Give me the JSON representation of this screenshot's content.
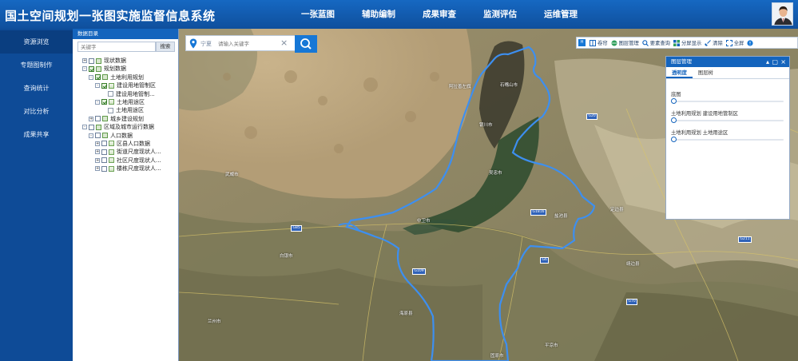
{
  "header": {
    "title": "国土空间规划一张图实施监督信息系统",
    "nav": [
      "一张蓝图",
      "辅助编制",
      "成果审查",
      "监测评估",
      "运维管理"
    ]
  },
  "rail": {
    "items": [
      "资源浏览",
      "专题图制作",
      "查询统计",
      "对比分析",
      "成果共享"
    ]
  },
  "catalog": {
    "title": "数据目录",
    "search_placeholder": "关键字",
    "search_button": "搜索",
    "tree": [
      {
        "label": "现状数据",
        "level": 0,
        "toggle": "+",
        "checked": false,
        "icon": "folder"
      },
      {
        "label": "规划数据",
        "level": 0,
        "toggle": "-",
        "checked": true,
        "icon": "folder"
      },
      {
        "label": "土地利用规划",
        "level": 1,
        "toggle": "-",
        "checked": true,
        "icon": "folder"
      },
      {
        "label": "建设用地管制区",
        "level": 2,
        "toggle": "-",
        "checked": true,
        "icon": "layer"
      },
      {
        "label": "建设用地管制...",
        "level": 3,
        "toggle": "",
        "checked": null,
        "icon": "doc"
      },
      {
        "label": "土地用途区",
        "level": 2,
        "toggle": "-",
        "checked": true,
        "icon": "layer"
      },
      {
        "label": "土地用途区",
        "level": 3,
        "toggle": "",
        "checked": null,
        "icon": "doc"
      },
      {
        "label": "城乡建设规划",
        "level": 1,
        "toggle": "+",
        "checked": false,
        "icon": "folder"
      },
      {
        "label": "区域及城市运行数据",
        "level": 0,
        "toggle": "-",
        "checked": false,
        "icon": "folder"
      },
      {
        "label": "人口数据",
        "level": 1,
        "toggle": "-",
        "checked": false,
        "icon": "folder"
      },
      {
        "label": "区县人口数据",
        "level": 2,
        "toggle": "+",
        "checked": false,
        "icon": "layer"
      },
      {
        "label": "街道尺度现状人...",
        "level": 2,
        "toggle": "+",
        "checked": false,
        "icon": "layer"
      },
      {
        "label": "社区尺度现状人...",
        "level": 2,
        "toggle": "+",
        "checked": false,
        "icon": "layer"
      },
      {
        "label": "楼栋尺度现状人...",
        "level": 2,
        "toggle": "+",
        "checked": false,
        "icon": "layer"
      }
    ]
  },
  "map": {
    "search": {
      "city": "宁夏",
      "placeholder": "请输入关键字"
    },
    "toolbar": [
      "卷帘",
      "图层管理",
      "要素查询",
      "分屏显示",
      "清除",
      "全屏"
    ],
    "toolbar_left_badge": "H",
    "labels": [
      {
        "text": "阿拉善左旗"
      },
      {
        "text": "石嘴山市"
      },
      {
        "text": "银川市"
      },
      {
        "text": "吴忠市"
      },
      {
        "text": "中卫市"
      },
      {
        "text": "固原市"
      },
      {
        "text": "盐池县"
      },
      {
        "text": "武威市"
      },
      {
        "text": "白银市"
      },
      {
        "text": "定边县"
      },
      {
        "text": "海原县"
      },
      {
        "text": "平凉市"
      },
      {
        "text": "靖边县"
      },
      {
        "text": "兰州市"
      }
    ],
    "shields": [
      "G6",
      "G20",
      "G85",
      "G1816",
      "G70",
      "G109",
      "G211"
    ]
  },
  "layer_panel": {
    "title": "图层管理",
    "tabs": [
      "透明度",
      "图层树"
    ],
    "active_tab": 0,
    "items": [
      {
        "name": "底图",
        "opacity": 0
      },
      {
        "name": "土地利用规划 建设用地管制区",
        "opacity": 0
      },
      {
        "name": "土地利用规划 土地用途区",
        "opacity": 0
      }
    ]
  },
  "colors": {
    "header": "#1262b8",
    "rail": "#0e4b97",
    "accent": "#1677d6",
    "boundary": "#3d8ff0"
  }
}
